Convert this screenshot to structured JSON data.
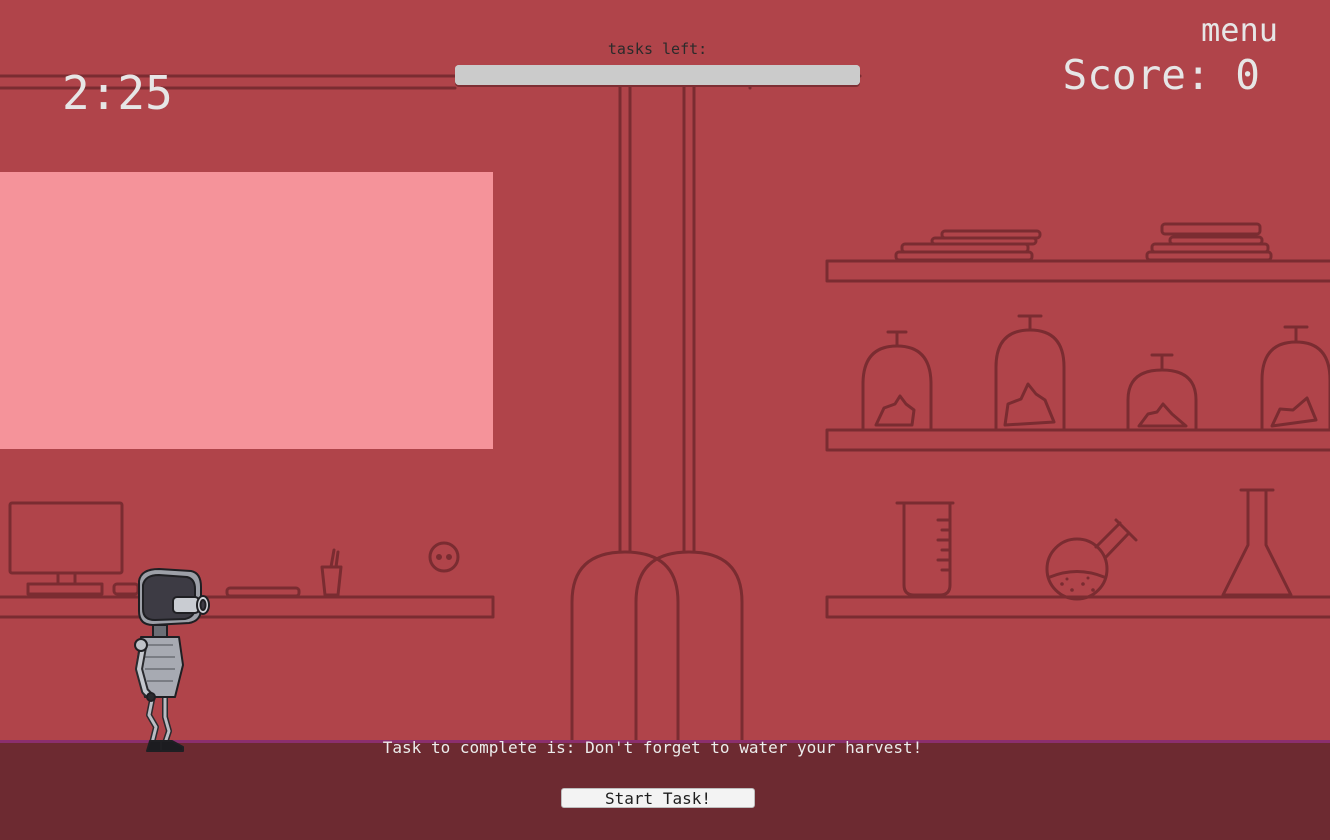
{
  "hud": {
    "timer": "2:25",
    "menu_label": "menu",
    "score_label": "Score: 0",
    "tasks_left_label": "tasks left:",
    "tasks_left_progress": 1.0
  },
  "task_panel": {
    "task_text": "Task to complete is: Don't forget to water your harvest!",
    "start_button_label": "Start Task!"
  },
  "colors": {
    "background": "#b0444a",
    "line_art": "#7a2c31",
    "window": "#f5939a",
    "floor": "#6d2a31",
    "floor_edge": "#8b2f6e",
    "hud_text": "#e6e6e6",
    "progress_bar": "#cbcbcb"
  },
  "scene": {
    "location": "laboratory",
    "objects": [
      "window",
      "computer-monitor",
      "pen-cup",
      "wall-socket",
      "ceiling-pipes",
      "books",
      "specimen-bell-jars",
      "measuring-beaker",
      "round-flask",
      "conical-flask"
    ],
    "player": "robot"
  }
}
